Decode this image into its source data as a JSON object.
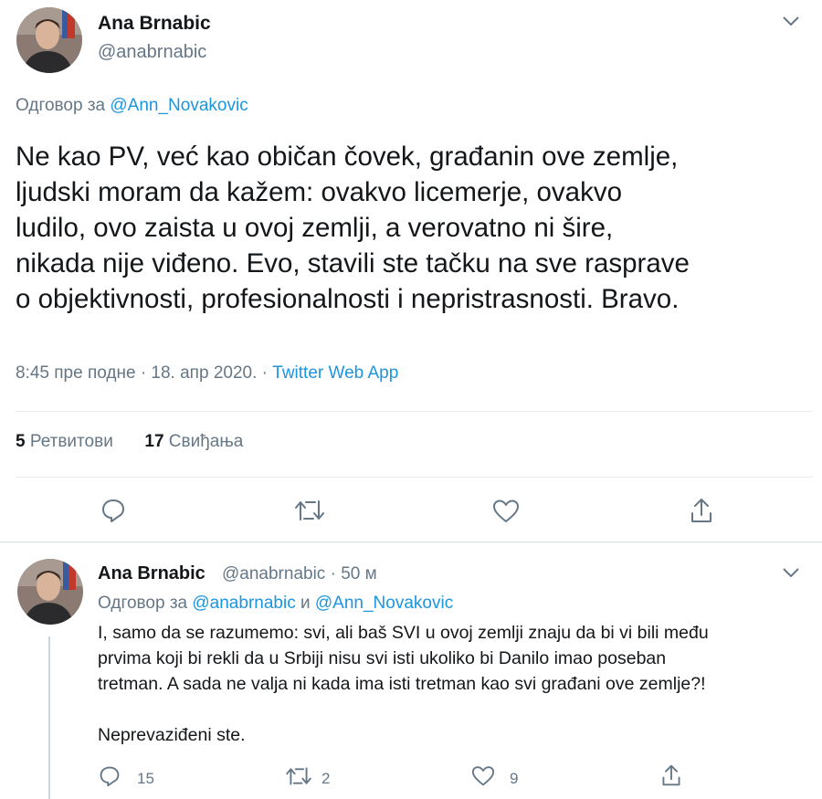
{
  "main_tweet": {
    "author_name": "Ana Brnabic",
    "author_handle": "@anabrnabic",
    "reply_prefix": "Одговор за",
    "reply_to": "@Ann_Novakovic",
    "lines": [
      "Ne kao PV, već kao običan čovek, građanin ove zemlje,",
      "ljudski moram da kažem: ovakvo licemerje, ovakvo",
      "ludilo, ovo zaista u ovoj zemlji, a verovatno ni šire,",
      "nikada nije viđeno. Evo, stavili ste tačku na sve rasprave",
      "o objektivnosti, profesionalnosti i nepristrasnosti. Bravo."
    ],
    "timestamp": "8:45 пре подне · 18. апр 2020. ·",
    "source": "Twitter Web App",
    "retweets_count": "5",
    "retweets_label": "Ретвитови",
    "likes_count": "17",
    "likes_label": "Свиђања"
  },
  "reply_tweet": {
    "author_name": "Ana Brnabic",
    "author_handle": "@anabrnabic · 50 м",
    "reply_prefix": "Одговор за",
    "reply_to_1": "@anabrnabic",
    "reply_and": "и",
    "reply_to_2": "@Ann_Novakovic",
    "text": "I, samo da se razumemo: svi, ali baš SVI u ovoj zemlji znaju da bi vi bili među\nprvima koji bi rekli da u Srbiji nisu svi isti ukoliko bi Danilo imao poseban\ntretman. A sada ne valja ni kada ima isti tretman kao svi građani ove zemlje?!\n\nNeprevaziđeni ste.",
    "reply_count": "15",
    "retweet_count": "2",
    "like_count": "9"
  },
  "colors": {
    "accent": "#1b95e0",
    "muted": "#657786",
    "border": "#e6ecf0"
  },
  "icons": [
    "chevron-down-icon",
    "reply-icon",
    "retweet-icon",
    "like-icon",
    "share-icon"
  ]
}
